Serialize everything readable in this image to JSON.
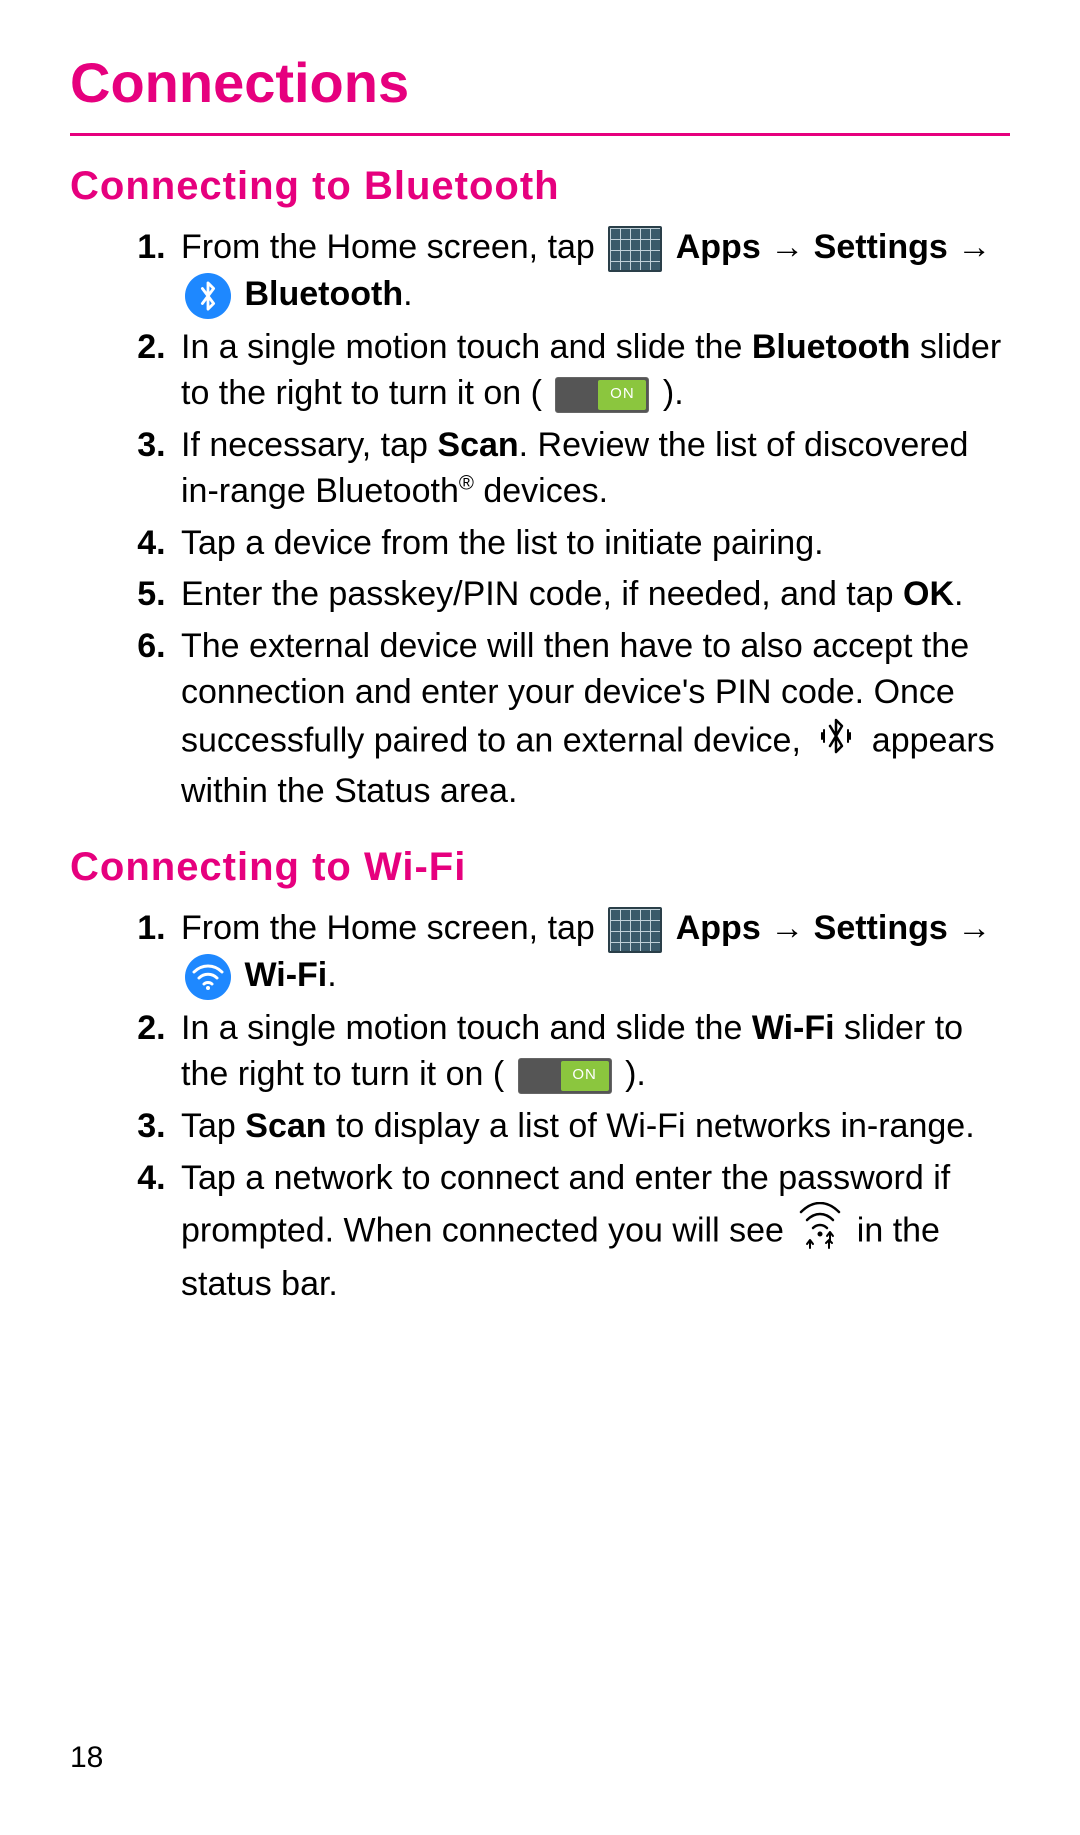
{
  "title": "Connections",
  "page_number": "18",
  "colors": {
    "accent": "#e6007e",
    "toggle_on": "#8bc63e",
    "icon_bg": "#1e88ff"
  },
  "sections": [
    {
      "heading": "Connecting to Bluetooth",
      "steps": [
        {
          "pre_text": "From the Home screen, tap ",
          "apps_label": "Apps",
          "mid_text": " → ",
          "settings_label": "Settings",
          "post_arrow": " → ",
          "feature_label": "Bluetooth",
          "tail": ".",
          "icon": "bluetooth"
        },
        {
          "t1": "In a single motion touch and slide the ",
          "bold": "Bluetooth",
          "t2": " slider to the right to turn it on ( ",
          "toggle_label": "ON",
          "t3": " )."
        },
        {
          "t1": "If necessary, tap ",
          "bold": "Scan",
          "t2": ". Review the list of discovered in-range Bluetooth",
          "reg": "®",
          "t3": " devices."
        },
        {
          "t1": "Tap a device from the list to initiate pairing."
        },
        {
          "t1": "Enter the passkey/PIN code, if needed, and tap ",
          "bold": "OK",
          "t2": "."
        },
        {
          "t1": "The external device will then have to also accept the connection and enter your device's PIN code. Once successfully paired to an external device, ",
          "t2": " appears within the Status area.",
          "icon": "bt-paired"
        }
      ]
    },
    {
      "heading": "Connecting to Wi-Fi",
      "steps": [
        {
          "pre_text": "From the Home screen, tap ",
          "apps_label": "Apps",
          "mid_text": " → ",
          "settings_label": "Settings",
          "post_arrow": " → ",
          "feature_label": "Wi-Fi",
          "tail": ".",
          "icon": "wifi"
        },
        {
          "t1": "In a single motion touch and slide the ",
          "bold": "Wi-Fi",
          "t2": " slider to the right to turn it on ( ",
          "toggle_label": "ON",
          "t3": " )."
        },
        {
          "t1": "Tap ",
          "bold": "Scan",
          "t2": " to display a list of Wi-Fi networks in-range."
        },
        {
          "t1": "Tap a network to connect and enter the password if prompted. When connected you will see ",
          "t2": " in the status bar.",
          "icon": "wifi-connected"
        }
      ]
    }
  ]
}
